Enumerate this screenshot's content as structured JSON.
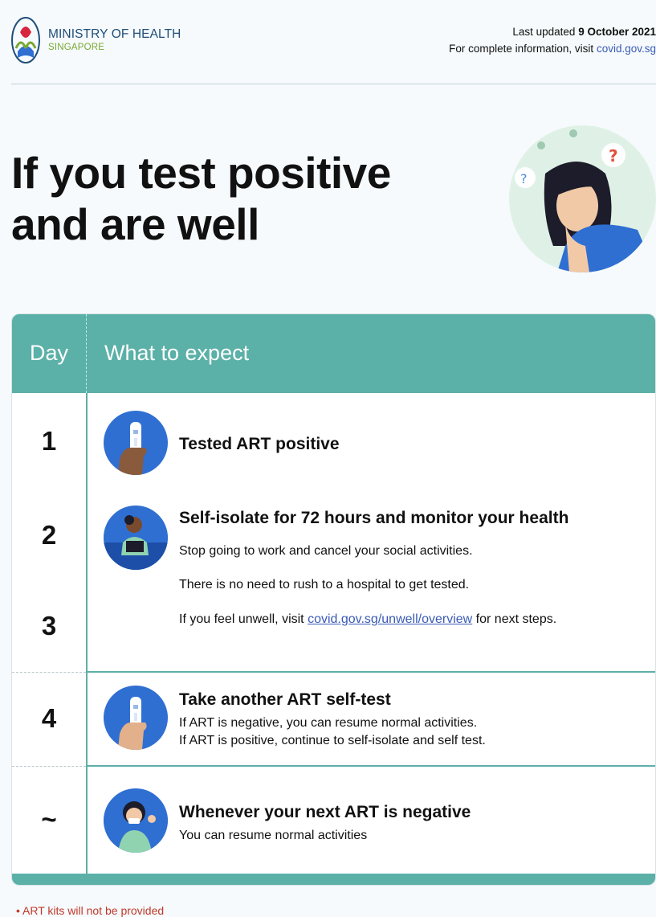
{
  "header": {
    "org_name": "MINISTRY OF HEALTH",
    "org_sub": "SINGAPORE",
    "updated_label": "Last updated",
    "updated_date": "9 October 2021",
    "complete_label": "For complete information, visit",
    "complete_link": "covid.gov.sg"
  },
  "title": {
    "line1": "If you test positive",
    "line2": "and are well"
  },
  "table": {
    "col_day": "Day",
    "col_what": "What to expect",
    "rows": [
      {
        "day": "1",
        "title": "Tested ART positive",
        "icon": "art-test-kit-icon"
      },
      {
        "day": "2",
        "title": "Self-isolate for 72 hours and monitor your health",
        "text1": "Stop going to work and cancel your social activities.",
        "text2": "There is no need to rush to a hospital to get tested.",
        "text3_before": "If you feel unwell, visit",
        "text3_link": "covid.gov.sg/unwell/overview",
        "text3_after": "for next steps.",
        "icon": "person-reading-icon"
      },
      {
        "day": "3"
      },
      {
        "day": "4",
        "title": "Take another ART self-test",
        "text1": "If ART is negative, you can resume normal activities.",
        "text2": "If ART is positive, continue to self-isolate and self test.",
        "icon": "art-test-kit-icon"
      },
      {
        "day": "~",
        "title": "Whenever your next ART is negative",
        "text1": "You can resume normal activities",
        "icon": "person-ok-gesture-icon"
      }
    ]
  },
  "footnote": "ART kits will not be provided",
  "colors": {
    "accent": "#5bb0a7",
    "icon_bg": "#2f6fd2",
    "link": "#3a5bb5",
    "org_blue": "#1f4e79",
    "org_green": "#7aa832",
    "note_red": "#c0392b"
  }
}
